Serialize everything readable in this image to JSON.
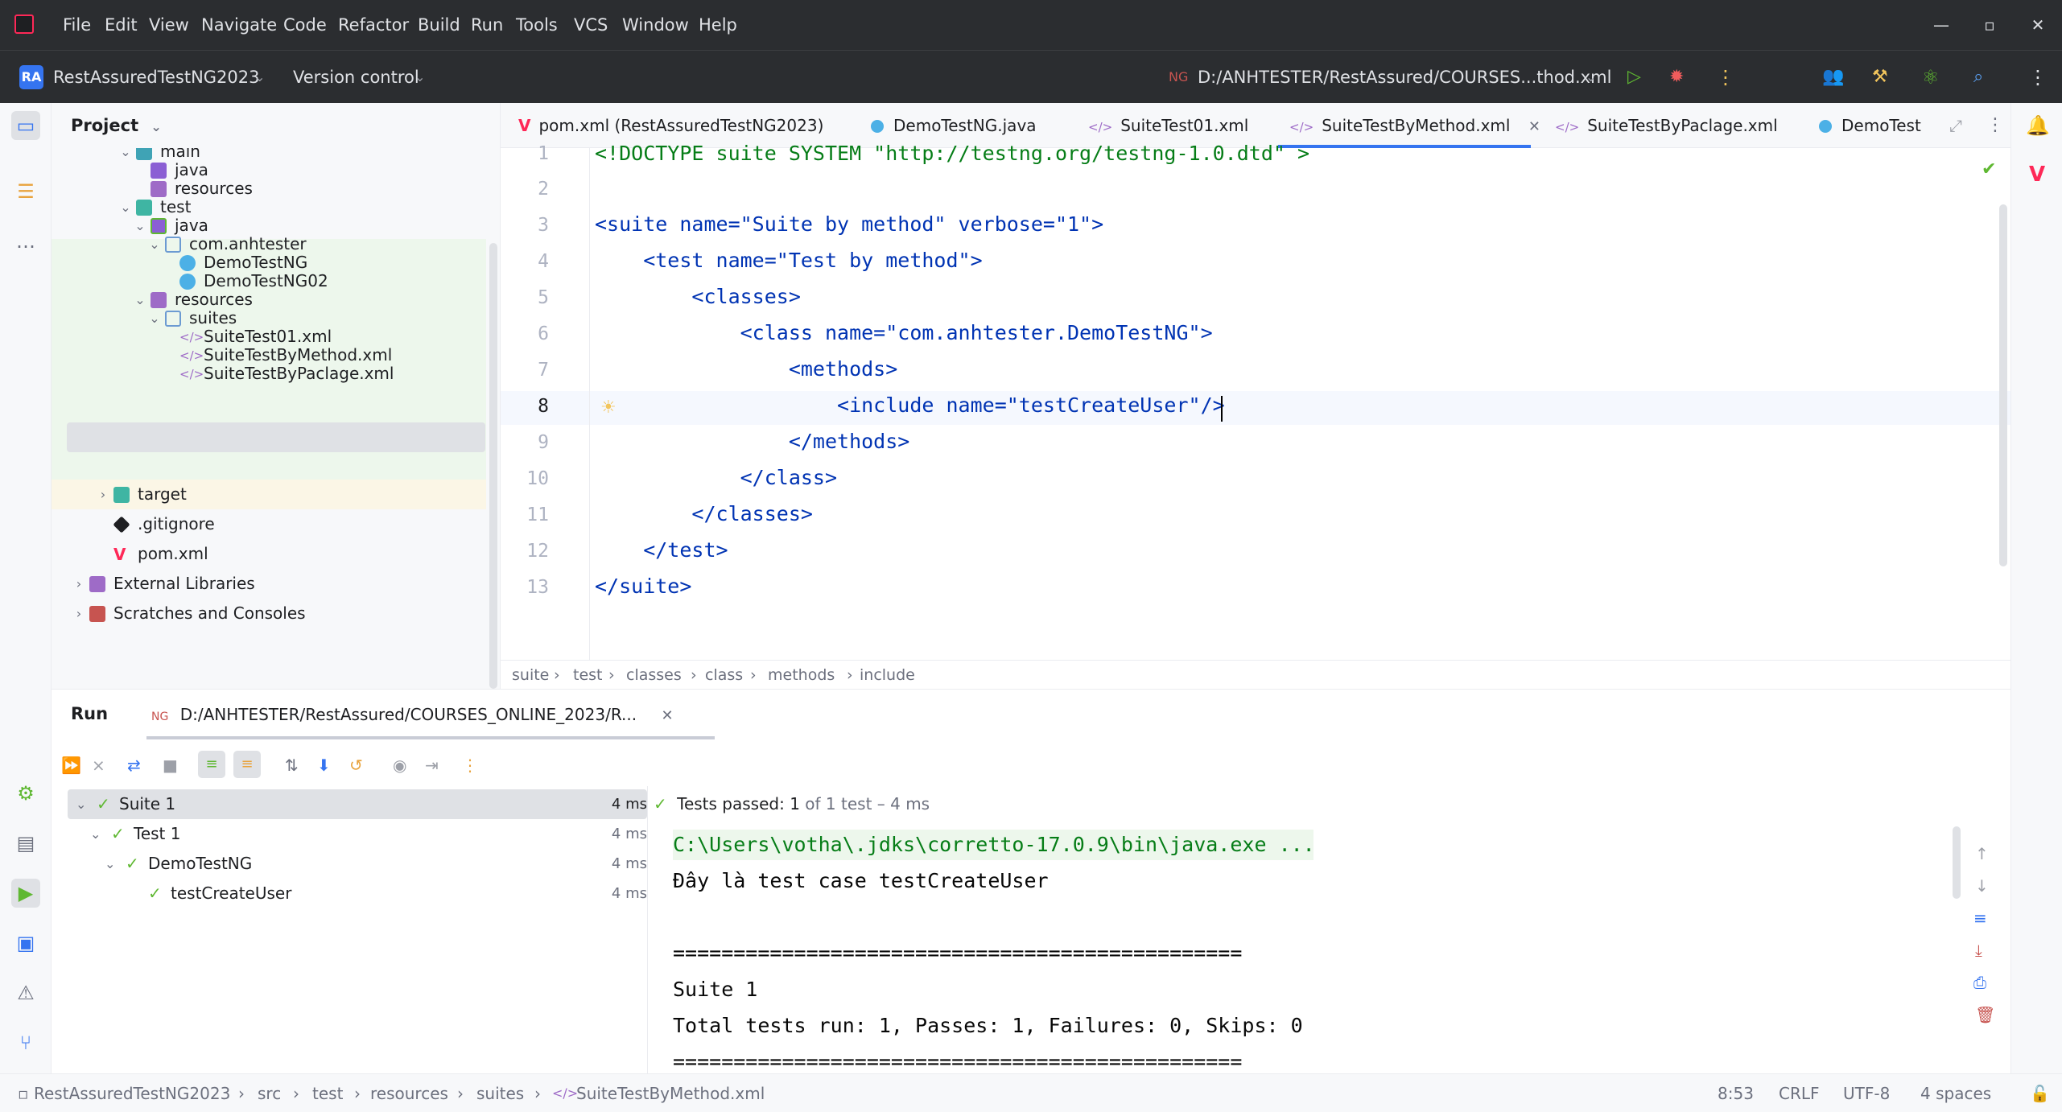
{
  "menubar": {
    "items": [
      "File",
      "Edit",
      "View",
      "Navigate",
      "Code",
      "Refactor",
      "Build",
      "Run",
      "Tools",
      "VCS",
      "Window",
      "Help"
    ]
  },
  "toolbar": {
    "project_badge": "RA",
    "project_name": "RestAssuredTestNG2023",
    "version_control": "Version control",
    "run_config": "D:/ANHTESTER/RestAssured/COURSES...thod.xml"
  },
  "project_panel": {
    "title": "Project",
    "items": [
      {
        "label": "main",
        "type": "folder"
      },
      {
        "label": "java",
        "type": "source"
      },
      {
        "label": "resources",
        "type": "resources"
      },
      {
        "label": "test",
        "type": "test-folder"
      },
      {
        "label": "java",
        "type": "test-source"
      },
      {
        "label": "com.anhtester",
        "type": "package"
      },
      {
        "label": "DemoTestNG",
        "type": "class"
      },
      {
        "label": "DemoTestNG02",
        "type": "class"
      },
      {
        "label": "resources",
        "type": "test-resources"
      },
      {
        "label": "suites",
        "type": "package"
      },
      {
        "label": "SuiteTest01.xml",
        "type": "xml"
      },
      {
        "label": "SuiteTestByMethod.xml",
        "type": "xml"
      },
      {
        "label": "SuiteTestByPaclage.xml",
        "type": "xml"
      },
      {
        "label": "target",
        "type": "excluded"
      },
      {
        "label": ".gitignore",
        "type": "git"
      },
      {
        "label": "pom.xml",
        "type": "maven"
      },
      {
        "label": "External Libraries",
        "type": "library"
      },
      {
        "label": "Scratches and Consoles",
        "type": "scratch"
      }
    ]
  },
  "tabs": [
    {
      "label": "pom.xml (RestAssuredTestNG2023)",
      "icon": "maven-icon"
    },
    {
      "label": "DemoTestNG.java",
      "icon": "class-icon"
    },
    {
      "label": "SuiteTest01.xml",
      "icon": "xml-icon"
    },
    {
      "label": "SuiteTestByMethod.xml",
      "icon": "xml-icon",
      "active": true
    },
    {
      "label": "SuiteTestByPaclage.xml",
      "icon": "xml-icon"
    },
    {
      "label": "DemoTest",
      "icon": "class-icon"
    }
  ],
  "editor": {
    "line_numbers": [
      "1",
      "2",
      "3",
      "4",
      "5",
      "6",
      "7",
      "8",
      "9",
      "10",
      "11",
      "12",
      "13"
    ],
    "lines": [
      "<!DOCTYPE suite SYSTEM \"http://testng.org/testng-1.0.dtd\" >",
      "",
      "<suite name=\"Suite by method\" verbose=\"1\">",
      "    <test name=\"Test by method\">",
      "        <classes>",
      "            <class name=\"com.anhtester.DemoTestNG\">",
      "                <methods>",
      "                    <include name=\"testCreateUser\"/>",
      "                </methods>",
      "            </class>",
      "        </classes>",
      "    </test>",
      "</suite>"
    ],
    "breadcrumbs": [
      "suite",
      "test",
      "classes",
      "class",
      "methods",
      "include"
    ]
  },
  "run_panel": {
    "title": "Run",
    "config_tab": "D:/ANHTESTER/RestAssured/COURSES_ONLINE_2023/R...",
    "tree": [
      {
        "label": "Suite 1",
        "time": "4 ms"
      },
      {
        "label": "Test 1",
        "time": "4 ms"
      },
      {
        "label": "DemoTestNG",
        "time": "4 ms"
      },
      {
        "label": "testCreateUser",
        "time": "4 ms"
      }
    ],
    "status_prefix": "Tests passed:",
    "status_count": "1",
    "status_suffix": "of 1 test – 4 ms",
    "console": [
      "C:\\Users\\votha\\.jdks\\corretto-17.0.9\\bin\\java.exe ...",
      "Đây là test case testCreateUser",
      "",
      "===============================================",
      "Suite 1",
      "Total tests run: 1, Passes: 1, Failures: 0, Skips: 0",
      "==============================================="
    ]
  },
  "statusbar": {
    "path": [
      "RestAssuredTestNG2023",
      "src",
      "test",
      "resources",
      "suites",
      "SuiteTestByMethod.xml"
    ],
    "position": "8:53",
    "line_ending": "CRLF",
    "encoding": "UTF-8",
    "indent": "4 spaces"
  }
}
